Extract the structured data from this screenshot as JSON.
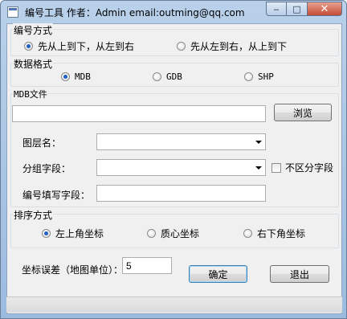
{
  "window": {
    "title": "编号工具 作者：Admin email:outming@qq.com"
  },
  "numbering_mode": {
    "label": "编号方式",
    "options": [
      {
        "label": "先从上到下，从左到右",
        "selected": true
      },
      {
        "label": "先从左到右，从上到下",
        "selected": false
      }
    ]
  },
  "data_format": {
    "label": "数据格式",
    "options": [
      {
        "label": "MDB",
        "selected": true
      },
      {
        "label": "GDB",
        "selected": false
      },
      {
        "label": "SHP",
        "selected": false
      }
    ]
  },
  "mdb_file": {
    "label": "MDB文件",
    "path_value": "",
    "browse_label": "浏览",
    "layer_name_label": "图层名：",
    "layer_name_value": "",
    "group_field_label": "分组字段：",
    "group_field_value": "",
    "case_insensitive_label": "不区分字段",
    "case_insensitive_checked": false,
    "number_field_label": "编号填写字段：",
    "number_field_value": ""
  },
  "sort_mode": {
    "label": "排序方式",
    "options": [
      {
        "label": "左上角坐标",
        "selected": true
      },
      {
        "label": "质心坐标",
        "selected": false
      },
      {
        "label": "右下角坐标",
        "selected": false
      }
    ]
  },
  "tolerance": {
    "label": "坐标误差（地图单位）：",
    "value": "5"
  },
  "actions": {
    "ok_label": "确定",
    "exit_label": "退出"
  },
  "icons": {
    "app": "app-icon",
    "minimize": "minimize-icon",
    "maximize": "maximize-icon",
    "close": "close-icon"
  }
}
